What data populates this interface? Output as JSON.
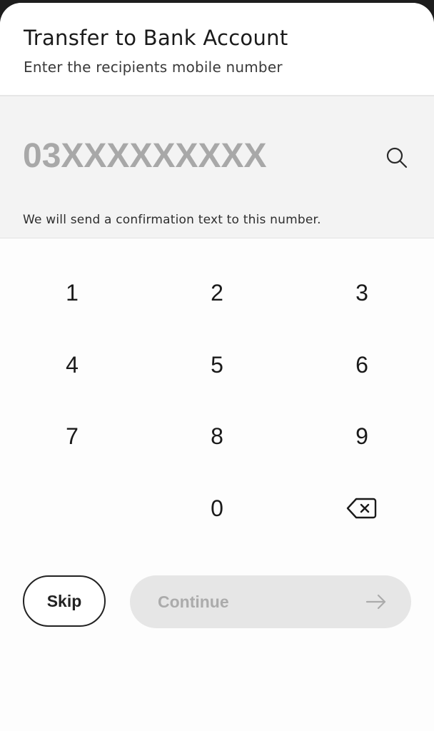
{
  "header": {
    "title": "Transfer to Bank Account",
    "subtitle": "Enter the recipients mobile number"
  },
  "entry": {
    "value": "",
    "placeholder": "03XXXXXXXXX",
    "search_icon": "search-icon",
    "hint": "We will send a confirmation text to this number."
  },
  "keypad": {
    "keys": [
      "1",
      "2",
      "3",
      "4",
      "5",
      "6",
      "7",
      "8",
      "9",
      "0"
    ],
    "backspace_icon": "backspace-icon"
  },
  "actions": {
    "skip_label": "Skip",
    "continue_label": "Continue",
    "continue_icon": "arrow-right-icon",
    "continue_enabled": false
  },
  "colors": {
    "background": "#ffffff",
    "entry_background": "#f3f3f3",
    "placeholder": "#a8a8a8",
    "disabled_button": "#e6e6e6",
    "disabled_text": "#ababab",
    "text_primary": "#1a1a1a"
  }
}
